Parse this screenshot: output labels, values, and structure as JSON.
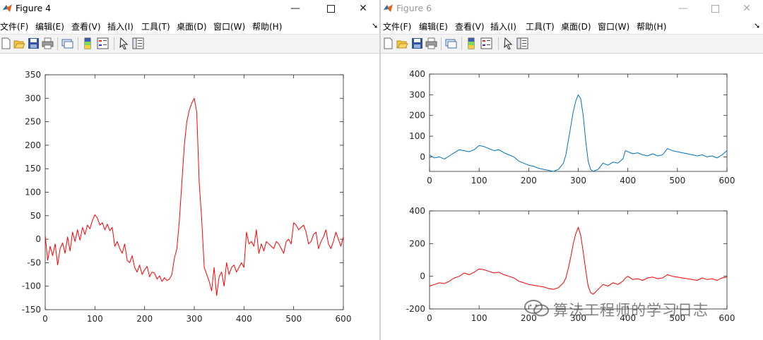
{
  "windows": [
    {
      "title": "Figure 4",
      "menus": [
        "文件(F)",
        "编辑(E)",
        "查看(V)",
        "插入(I)",
        "工具(T)",
        "桌面(D)",
        "窗口(W)",
        "帮助(H)"
      ]
    },
    {
      "title": "Figure 6",
      "menus": [
        "文件(F)",
        "编辑(E)",
        "查看(V)",
        "插入(I)",
        "工具(T)",
        "桌面(D)",
        "窗口(W)",
        "帮助(H)"
      ]
    }
  ],
  "watermark": {
    "text": "算法工程师的学习日志"
  },
  "colors": {
    "red": "#ff0000",
    "blue": "#0072bd",
    "axis": "#262626",
    "toolbar": "#f3f3f3"
  },
  "icons": [
    "new-figure-icon",
    "open-icon",
    "save-icon",
    "print-icon",
    "link-icon",
    "colorbar-icon",
    "legend-icon",
    "pointer-icon",
    "property-editor-icon"
  ],
  "chart_data": [
    {
      "type": "line",
      "panel": "figure4",
      "x": [
        0,
        5,
        10,
        15,
        20,
        25,
        30,
        35,
        40,
        45,
        50,
        55,
        60,
        65,
        70,
        75,
        80,
        85,
        90,
        95,
        100,
        105,
        110,
        115,
        120,
        125,
        130,
        135,
        140,
        145,
        150,
        155,
        160,
        165,
        170,
        175,
        180,
        185,
        190,
        195,
        200,
        205,
        210,
        215,
        220,
        225,
        230,
        235,
        240,
        245,
        250,
        255,
        260,
        265,
        270,
        275,
        280,
        285,
        290,
        295,
        300,
        305,
        310,
        315,
        320,
        325,
        330,
        335,
        340,
        345,
        350,
        355,
        360,
        365,
        370,
        375,
        380,
        385,
        390,
        395,
        400,
        405,
        410,
        415,
        420,
        425,
        430,
        435,
        440,
        445,
        450,
        455,
        460,
        465,
        470,
        475,
        480,
        485,
        490,
        495,
        500,
        505,
        510,
        515,
        520,
        525,
        530,
        535,
        540,
        545,
        550,
        555,
        560,
        565,
        570,
        575,
        580,
        585,
        590,
        595,
        600
      ],
      "y": [
        8,
        -45,
        -15,
        -35,
        -10,
        -55,
        -20,
        -8,
        -30,
        5,
        -25,
        15,
        -5,
        20,
        -2,
        25,
        10,
        30,
        22,
        40,
        52,
        45,
        30,
        35,
        20,
        32,
        18,
        25,
        -15,
        -5,
        -20,
        -30,
        -10,
        -45,
        -50,
        -35,
        -60,
        -70,
        -55,
        -75,
        -65,
        -58,
        -80,
        -70,
        -72,
        -85,
        -78,
        -90,
        -82,
        -88,
        -85,
        -75,
        -40,
        -20,
        40,
        120,
        200,
        250,
        275,
        290,
        300,
        270,
        120,
        40,
        -60,
        -75,
        -90,
        -110,
        -60,
        -120,
        -80,
        -70,
        -100,
        -50,
        -75,
        -60,
        -55,
        -70,
        -60,
        -50,
        -60,
        15,
        -10,
        -5,
        -15,
        20,
        -30,
        -10,
        -25,
        -5,
        -10,
        -15,
        -20,
        -5,
        -10,
        -20,
        -30,
        -5,
        0,
        -10,
        35,
        30,
        20,
        25,
        30,
        15,
        -10,
        -5,
        10,
        15,
        -20,
        -5,
        5,
        20,
        -10,
        -20,
        -5,
        15,
        0,
        -15,
        5,
        -25,
        20
      ],
      "xlim": [
        0,
        600
      ],
      "ylim": [
        -150,
        350
      ],
      "xticks": [
        0,
        100,
        200,
        300,
        400,
        500,
        600
      ],
      "yticks": [
        -150,
        -100,
        -50,
        0,
        50,
        100,
        150,
        200,
        250,
        300,
        350
      ]
    },
    {
      "type": "line",
      "panel": "figure6-top",
      "x": [
        0,
        10,
        20,
        30,
        40,
        50,
        60,
        70,
        80,
        90,
        100,
        110,
        120,
        130,
        140,
        150,
        160,
        170,
        180,
        190,
        200,
        210,
        220,
        230,
        240,
        250,
        260,
        270,
        275,
        280,
        285,
        290,
        295,
        300,
        305,
        310,
        315,
        320,
        325,
        330,
        340,
        350,
        360,
        370,
        380,
        390,
        395,
        400,
        410,
        420,
        430,
        440,
        450,
        460,
        470,
        480,
        490,
        500,
        510,
        520,
        530,
        540,
        550,
        560,
        570,
        580,
        590,
        600
      ],
      "y": [
        10,
        -5,
        0,
        -10,
        5,
        20,
        35,
        30,
        25,
        35,
        55,
        50,
        40,
        30,
        35,
        20,
        10,
        0,
        -20,
        -30,
        -40,
        -45,
        -55,
        -60,
        -65,
        -70,
        -60,
        -30,
        10,
        80,
        150,
        220,
        270,
        300,
        280,
        200,
        80,
        -20,
        -60,
        -75,
        -60,
        -30,
        -40,
        -25,
        -30,
        -10,
        30,
        25,
        15,
        20,
        10,
        5,
        15,
        5,
        10,
        40,
        30,
        25,
        20,
        15,
        10,
        5,
        10,
        0,
        5,
        -5,
        10,
        30
      ],
      "xlim": [
        0,
        600
      ],
      "ylim": [
        -70,
        400
      ],
      "xticks": [
        0,
        100,
        200,
        300,
        400,
        500,
        600
      ],
      "yticks": [
        0,
        100,
        200,
        300,
        400
      ]
    },
    {
      "type": "line",
      "panel": "figure6-bottom",
      "x": [
        0,
        10,
        20,
        30,
        40,
        50,
        60,
        70,
        80,
        90,
        100,
        110,
        120,
        130,
        140,
        150,
        160,
        170,
        180,
        190,
        200,
        210,
        220,
        230,
        240,
        250,
        260,
        270,
        275,
        280,
        285,
        290,
        295,
        300,
        305,
        310,
        315,
        320,
        325,
        330,
        340,
        350,
        360,
        370,
        380,
        390,
        395,
        400,
        410,
        420,
        430,
        440,
        450,
        460,
        470,
        480,
        490,
        500,
        510,
        520,
        530,
        540,
        550,
        560,
        570,
        580,
        590,
        600
      ],
      "y": [
        -60,
        -50,
        -40,
        -45,
        -30,
        -10,
        0,
        20,
        10,
        25,
        45,
        40,
        30,
        20,
        25,
        10,
        0,
        -10,
        -30,
        -40,
        -50,
        -55,
        -60,
        -65,
        -75,
        -80,
        -70,
        -40,
        -10,
        50,
        120,
        200,
        260,
        300,
        250,
        150,
        40,
        -60,
        -100,
        -110,
        -80,
        -50,
        -60,
        -40,
        -50,
        -30,
        -10,
        0,
        -20,
        -15,
        -25,
        -10,
        -5,
        -15,
        -10,
        10,
        0,
        -5,
        -10,
        -15,
        -20,
        -25,
        -10,
        -20,
        -15,
        -25,
        -10,
        -5
      ],
      "xlim": [
        0,
        600
      ],
      "ylim": [
        -200,
        400
      ],
      "xticks": [
        0,
        100,
        200,
        300,
        400,
        500,
        600
      ],
      "yticks": [
        -200,
        0,
        200,
        400
      ]
    }
  ]
}
